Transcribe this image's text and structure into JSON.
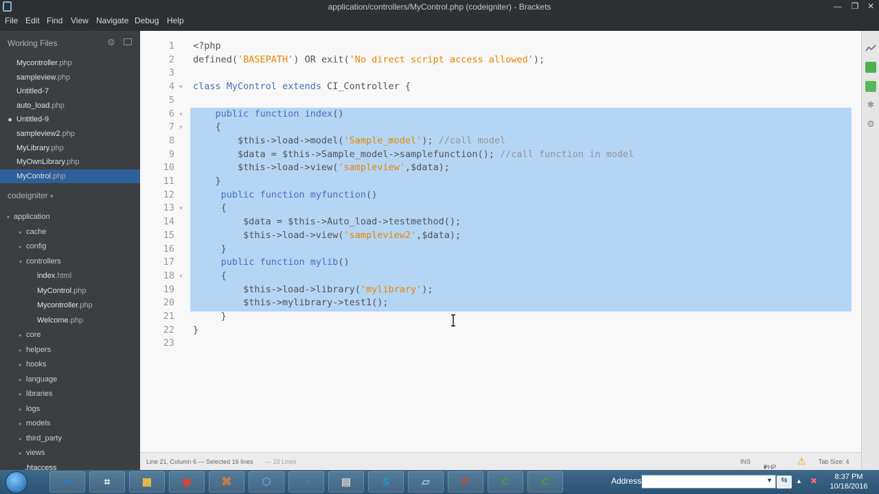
{
  "window": {
    "title": "application/controllers/MyControl.php (codeigniter) - Brackets",
    "minimize_glyph": "—",
    "restore_glyph": "❐",
    "close_glyph": "✕"
  },
  "menu": [
    "File",
    "Edit",
    "Find",
    "View",
    "Navigate",
    "Debug",
    "Help"
  ],
  "sidebar": {
    "working_files_title": "Working Files",
    "working_files": [
      {
        "name": "Mycontroller",
        "ext": ".php",
        "dirty": false,
        "selected": false
      },
      {
        "name": "sampleview",
        "ext": ".php",
        "dirty": false,
        "selected": false
      },
      {
        "name": "Untitled-7",
        "ext": "",
        "dirty": false,
        "selected": false
      },
      {
        "name": "auto_load",
        "ext": ".php",
        "dirty": false,
        "selected": false
      },
      {
        "name": "Untitled-9",
        "ext": "",
        "dirty": true,
        "selected": false
      },
      {
        "name": "sampleview2",
        "ext": ".php",
        "dirty": false,
        "selected": false
      },
      {
        "name": "MyLibrary",
        "ext": ".php",
        "dirty": false,
        "selected": false
      },
      {
        "name": "MyOwnLibrary",
        "ext": ".php",
        "dirty": false,
        "selected": false
      },
      {
        "name": "MyControl",
        "ext": ".php",
        "dirty": false,
        "selected": true
      }
    ],
    "project_title": "codeigniter",
    "project_title_arrow": "▾",
    "tree": [
      {
        "name": "application",
        "ext": "",
        "kind": "folder",
        "open": true,
        "depth": 0
      },
      {
        "name": "cache",
        "ext": "",
        "kind": "folder",
        "open": false,
        "depth": 1
      },
      {
        "name": "config",
        "ext": "",
        "kind": "folder",
        "open": false,
        "depth": 1
      },
      {
        "name": "controllers",
        "ext": "",
        "kind": "folder",
        "open": true,
        "depth": 1
      },
      {
        "name": "index",
        "ext": ".html",
        "kind": "file",
        "depth": 2
      },
      {
        "name": "MyControl",
        "ext": ".php",
        "kind": "file",
        "depth": 2
      },
      {
        "name": "Mycontroller",
        "ext": ".php",
        "kind": "file",
        "depth": 2
      },
      {
        "name": "Welcome",
        "ext": ".php",
        "kind": "file",
        "depth": 2
      },
      {
        "name": "core",
        "ext": "",
        "kind": "folder",
        "open": false,
        "depth": 1
      },
      {
        "name": "helpers",
        "ext": "",
        "kind": "folder",
        "open": false,
        "depth": 1
      },
      {
        "name": "hooks",
        "ext": "",
        "kind": "folder",
        "open": false,
        "depth": 1
      },
      {
        "name": "language",
        "ext": "",
        "kind": "folder",
        "open": false,
        "depth": 1
      },
      {
        "name": "libraries",
        "ext": "",
        "kind": "folder",
        "open": false,
        "depth": 1
      },
      {
        "name": "logs",
        "ext": "",
        "kind": "folder",
        "open": false,
        "depth": 1
      },
      {
        "name": "models",
        "ext": "",
        "kind": "folder",
        "open": false,
        "depth": 1
      },
      {
        "name": "third_party",
        "ext": "",
        "kind": "folder",
        "open": false,
        "depth": 1
      },
      {
        "name": "views",
        "ext": "",
        "kind": "folder",
        "open": false,
        "depth": 1
      },
      {
        "name": ".htaccess",
        "ext": "",
        "kind": "file",
        "depth": 1
      }
    ]
  },
  "editor": {
    "selection": {
      "from_line": 6,
      "to_line": 21
    },
    "lines": [
      [
        {
          "t": "<?php",
          "c": ""
        }
      ],
      [
        {
          "t": "defined(",
          "c": ""
        },
        {
          "t": "'BASEPATH'",
          "c": "str"
        },
        {
          "t": ") OR exit(",
          "c": ""
        },
        {
          "t": "'No direct script access allowed'",
          "c": "str"
        },
        {
          "t": ");",
          "c": ""
        }
      ],
      [],
      [
        {
          "t": "class",
          "c": "kw"
        },
        {
          "t": " ",
          "c": ""
        },
        {
          "t": "MyControl",
          "c": "kw"
        },
        {
          "t": " ",
          "c": ""
        },
        {
          "t": "extends",
          "c": "kw"
        },
        {
          "t": " CI_Controller {",
          "c": ""
        }
      ],
      [],
      [
        {
          "t": "    ",
          "c": ""
        },
        {
          "t": "public",
          "c": "kw"
        },
        {
          "t": " ",
          "c": ""
        },
        {
          "t": "function",
          "c": "kw"
        },
        {
          "t": " ",
          "c": ""
        },
        {
          "t": "index",
          "c": "kw"
        },
        {
          "t": "()",
          "c": ""
        }
      ],
      [
        {
          "t": "    {",
          "c": ""
        }
      ],
      [
        {
          "t": "        $this->load->model(",
          "c": ""
        },
        {
          "t": "'Sample_model'",
          "c": "str"
        },
        {
          "t": "); ",
          "c": ""
        },
        {
          "t": "//call model",
          "c": "cm"
        }
      ],
      [
        {
          "t": "        $data = $this->Sample_model->samplefunction(); ",
          "c": ""
        },
        {
          "t": "//call function in model",
          "c": "cm"
        }
      ],
      [
        {
          "t": "        $this->load->view(",
          "c": ""
        },
        {
          "t": "'sampleview'",
          "c": "str"
        },
        {
          "t": ",$data);",
          "c": ""
        }
      ],
      [
        {
          "t": "    }",
          "c": ""
        }
      ],
      [
        {
          "t": "     ",
          "c": ""
        },
        {
          "t": "public",
          "c": "kw"
        },
        {
          "t": " ",
          "c": ""
        },
        {
          "t": "function",
          "c": "kw"
        },
        {
          "t": " ",
          "c": ""
        },
        {
          "t": "myfunction",
          "c": "kw"
        },
        {
          "t": "()",
          "c": ""
        }
      ],
      [
        {
          "t": "     {",
          "c": ""
        }
      ],
      [
        {
          "t": "         $data = $this->Auto_load->testmethod();",
          "c": ""
        }
      ],
      [
        {
          "t": "         $this->load->view(",
          "c": ""
        },
        {
          "t": "'sampleview2'",
          "c": "str"
        },
        {
          "t": ",$data);",
          "c": ""
        }
      ],
      [
        {
          "t": "     }",
          "c": ""
        }
      ],
      [
        {
          "t": "     ",
          "c": ""
        },
        {
          "t": "public",
          "c": "kw"
        },
        {
          "t": " ",
          "c": ""
        },
        {
          "t": "function",
          "c": "kw"
        },
        {
          "t": " ",
          "c": ""
        },
        {
          "t": "mylib",
          "c": "kw"
        },
        {
          "t": "()",
          "c": ""
        }
      ],
      [
        {
          "t": "     {",
          "c": ""
        }
      ],
      [
        {
          "t": "         $this->load->library(",
          "c": ""
        },
        {
          "t": "'mylibrary'",
          "c": "str"
        },
        {
          "t": ");",
          "c": ""
        }
      ],
      [
        {
          "t": "         $this->mylibrary->test1();",
          "c": ""
        }
      ],
      [
        {
          "t": "     }",
          "c": ""
        }
      ],
      [
        {
          "t": "}",
          "c": ""
        }
      ],
      []
    ],
    "fold_lines": [
      4,
      6,
      7,
      13,
      18
    ]
  },
  "statusbar": {
    "position": "Line 21, Column 6 — Selected 16 lines",
    "line_count": "— 23 Lines",
    "ins": "INS",
    "language": "PHP",
    "language_arrow": "▾",
    "warning_icon": "⚠",
    "tab_size": "Tab Size: 4"
  },
  "taskbar": {
    "apps": [
      "e",
      "⌗",
      "▦",
      "◉",
      "⌘",
      "⬡",
      "◔",
      "▤",
      "S",
      "▱",
      "P",
      "C",
      "C"
    ],
    "address_label": "Address",
    "address_value": "",
    "go_glyph": "⇆",
    "tray_arrow": "▲",
    "tray_network": "✖",
    "time": "8:37 PM",
    "date": "10/16/2016"
  },
  "colors": {
    "accent_selected_file": "#2d6099",
    "selection": "#b5d5f5",
    "keyword": "#446fbd",
    "string": "#e88501",
    "comment": "#949494"
  }
}
